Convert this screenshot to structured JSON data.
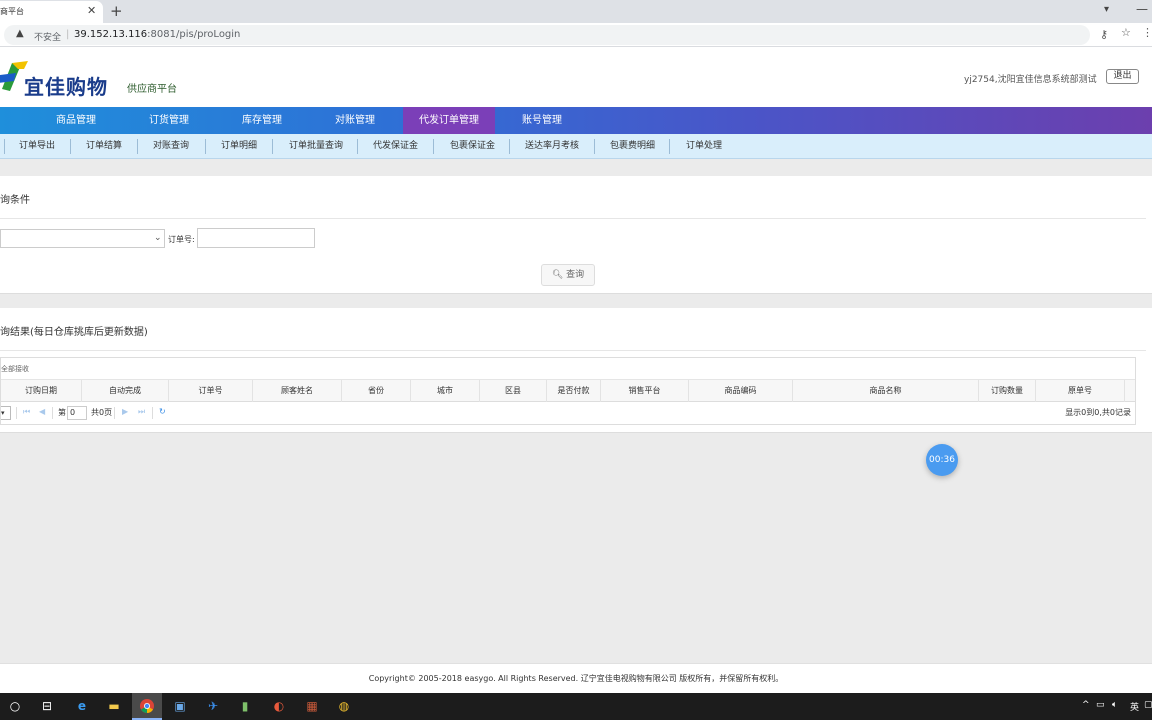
{
  "browser": {
    "tab_title": "商平台",
    "insecure_label": "不安全",
    "url_host": "39.152.13.116",
    "url_rest": ":8081/pis/proLogin"
  },
  "header": {
    "logo_text": "宜佳购物",
    "platform_label": "供应商平台",
    "user_info": "yj2754,沈阳宜佳信息系统部测试",
    "logout_label": "退出"
  },
  "main_nav": [
    {
      "label": "商品管理"
    },
    {
      "label": "订货管理"
    },
    {
      "label": "库存管理"
    },
    {
      "label": "对账管理"
    },
    {
      "label": "代发订单管理",
      "active": true
    },
    {
      "label": "账号管理"
    }
  ],
  "sub_nav": [
    {
      "label": "订单导出"
    },
    {
      "label": "订单结算"
    },
    {
      "label": "对账查询"
    },
    {
      "label": "订单明细"
    },
    {
      "label": "订单批量查询"
    },
    {
      "label": "代发保证金"
    },
    {
      "label": "包裹保证金"
    },
    {
      "label": "送达率月考核"
    },
    {
      "label": "包裹费明细"
    },
    {
      "label": "订单处理"
    }
  ],
  "query": {
    "title": "询条件",
    "select_value": "",
    "order_label": "订单号:",
    "order_value": "",
    "button_label": "查询"
  },
  "results": {
    "title": "询结果(每日仓库挑库后更新数据)",
    "toolbar_text": "全部接收",
    "columns": [
      "订购日期",
      "自动完成",
      "订单号",
      "顾客姓名",
      "省份",
      "城市",
      "区县",
      "是否付款",
      "销售平台",
      "商品编码",
      "商品名称",
      "订购数量",
      "原单号"
    ],
    "pager": {
      "page_prefix": "第",
      "page_value": "0",
      "page_total": "共0页",
      "summary": "显示0到0,共0记录"
    }
  },
  "timer_label": "00:36",
  "footer_text": "Copyright© 2005-2018 easygo. All Rights Reserved. 辽宁宜佳电视购物有限公司 版权所有，并保留所有权利。",
  "taskbar": {
    "lang_label": "英"
  },
  "colors": {
    "nav_active": "#7b3fb8",
    "subnav_bg": "#d9eefb",
    "timer": "#4a9bf0"
  }
}
